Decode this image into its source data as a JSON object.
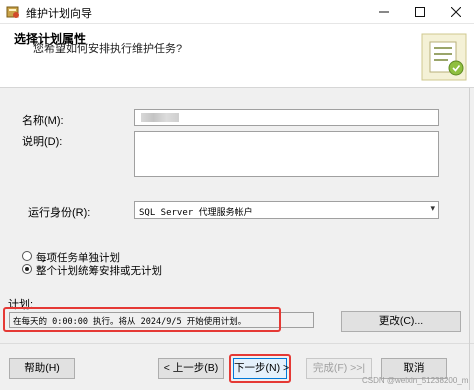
{
  "window": {
    "title": "维护计划向导"
  },
  "header": {
    "title": "选择计划属性",
    "subtitle": "您希望如何安排执行维护任务?"
  },
  "form": {
    "name_label": "名称(M):",
    "name_value": "",
    "description_label": "说明(D):",
    "run_as_label": "运行身份(R):",
    "run_as_value": "SQL Server 代理服务帐户",
    "option_separate": "每项任务单独计划",
    "option_single": "整个计划统筹安排或无计划",
    "selected_option": "option_single"
  },
  "schedule": {
    "label": "计划:",
    "value": "在每天的 0:00:00 执行。将从 2024/9/5 开始使用计划。",
    "change_button": "更改(C)..."
  },
  "footer": {
    "help": "帮助(H)",
    "back": "< 上一步(B)",
    "next": "下一步(N) >",
    "finish": "完成(F) >>|",
    "cancel": "取消"
  },
  "watermark": "CSDN @weixin_51238200_m",
  "colors": {
    "highlight": "#e53935",
    "focus_border": "#0078d7"
  },
  "icons": {
    "app": "wizard-icon",
    "header": "maintenance-plan-graphic"
  }
}
